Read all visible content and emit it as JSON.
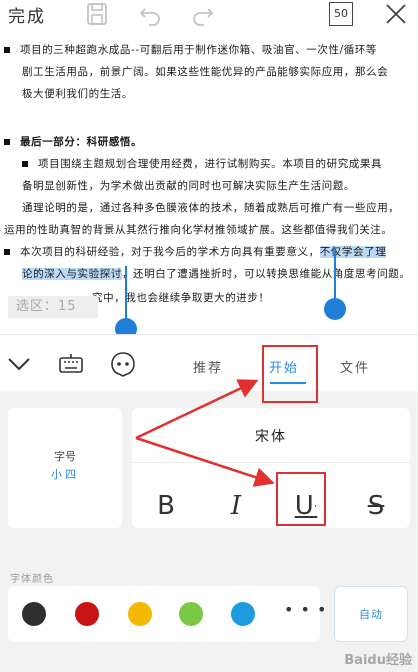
{
  "toolbar": {
    "done_label": "完成",
    "page_count": "50",
    "icons": [
      "save-icon",
      "undo-icon",
      "redo-icon",
      "page-count-icon",
      "close-icon"
    ]
  },
  "document": {
    "p1_line1": "项目的三种超跑水成品--可翻后用于制作迷你箱、吸油官、一次性/循环等",
    "p1_line2": "剧工生活用品，前景广阔。如果这些性能优异的产品能够实际应用，那么会",
    "p1_line3": "极大便利我们的生活。",
    "p2_heading": "最后一部分：科研感悟。",
    "p2_line1": "项目围绕主题规划合理使用经费，进行试制购买。本项目的研究成果具",
    "p2_line2": "备明显创新性，为学术做出贡献的同时也可解决实际生产生活问题。",
    "p2_line3": "通理论明的是，通过各种多色膜液体的技术，随着成熟后可推广有一些应用，",
    "p2_line4": "运用的性助真智的背景从其然行推向化学材推领域扩展。这些都值得我们关注。",
    "p3_line1_a": "本次项目的科研经验，对于我今后的学术方向具有重要意义，",
    "p3_line1_sel": "不仅学会了理",
    "p3_line2_sel": "论的深入与实验探讨",
    "p3_line2_b": "，还明白了遭遇挫折时，可以转换思维能从角度思考问题。",
    "p3_line3": "究中，我也会继续争取更大的进步！",
    "selection_count_label": "选区：15"
  },
  "bottom_panel": {
    "tabs": [
      {
        "icon": "collapse-chevron-icon"
      },
      {
        "icon": "keyboard-icon"
      },
      {
        "icon": "assistant-icon"
      },
      {
        "label": "推荐"
      },
      {
        "label": "开始"
      },
      {
        "label": "文件"
      }
    ],
    "active_tab": "开始",
    "font_size": {
      "title": "字号",
      "value": "小四"
    },
    "font_name": "宋体",
    "format_buttons": [
      {
        "label": "B",
        "name": "bold"
      },
      {
        "label": "I",
        "name": "italic"
      },
      {
        "label": "U",
        "name": "underline"
      },
      {
        "label": "S",
        "name": "strikethrough"
      }
    ],
    "font_color_label": "字体颜色",
    "colors": [
      "#2f2f2f",
      "#c81414",
      "#f5b800",
      "#7ac943",
      "#1e9be0"
    ],
    "more_label": "• • •",
    "auto_label": "自动"
  },
  "accent_color": "#2b8ae2",
  "annotation_color": "#e03030",
  "watermark": "Baidu经验"
}
